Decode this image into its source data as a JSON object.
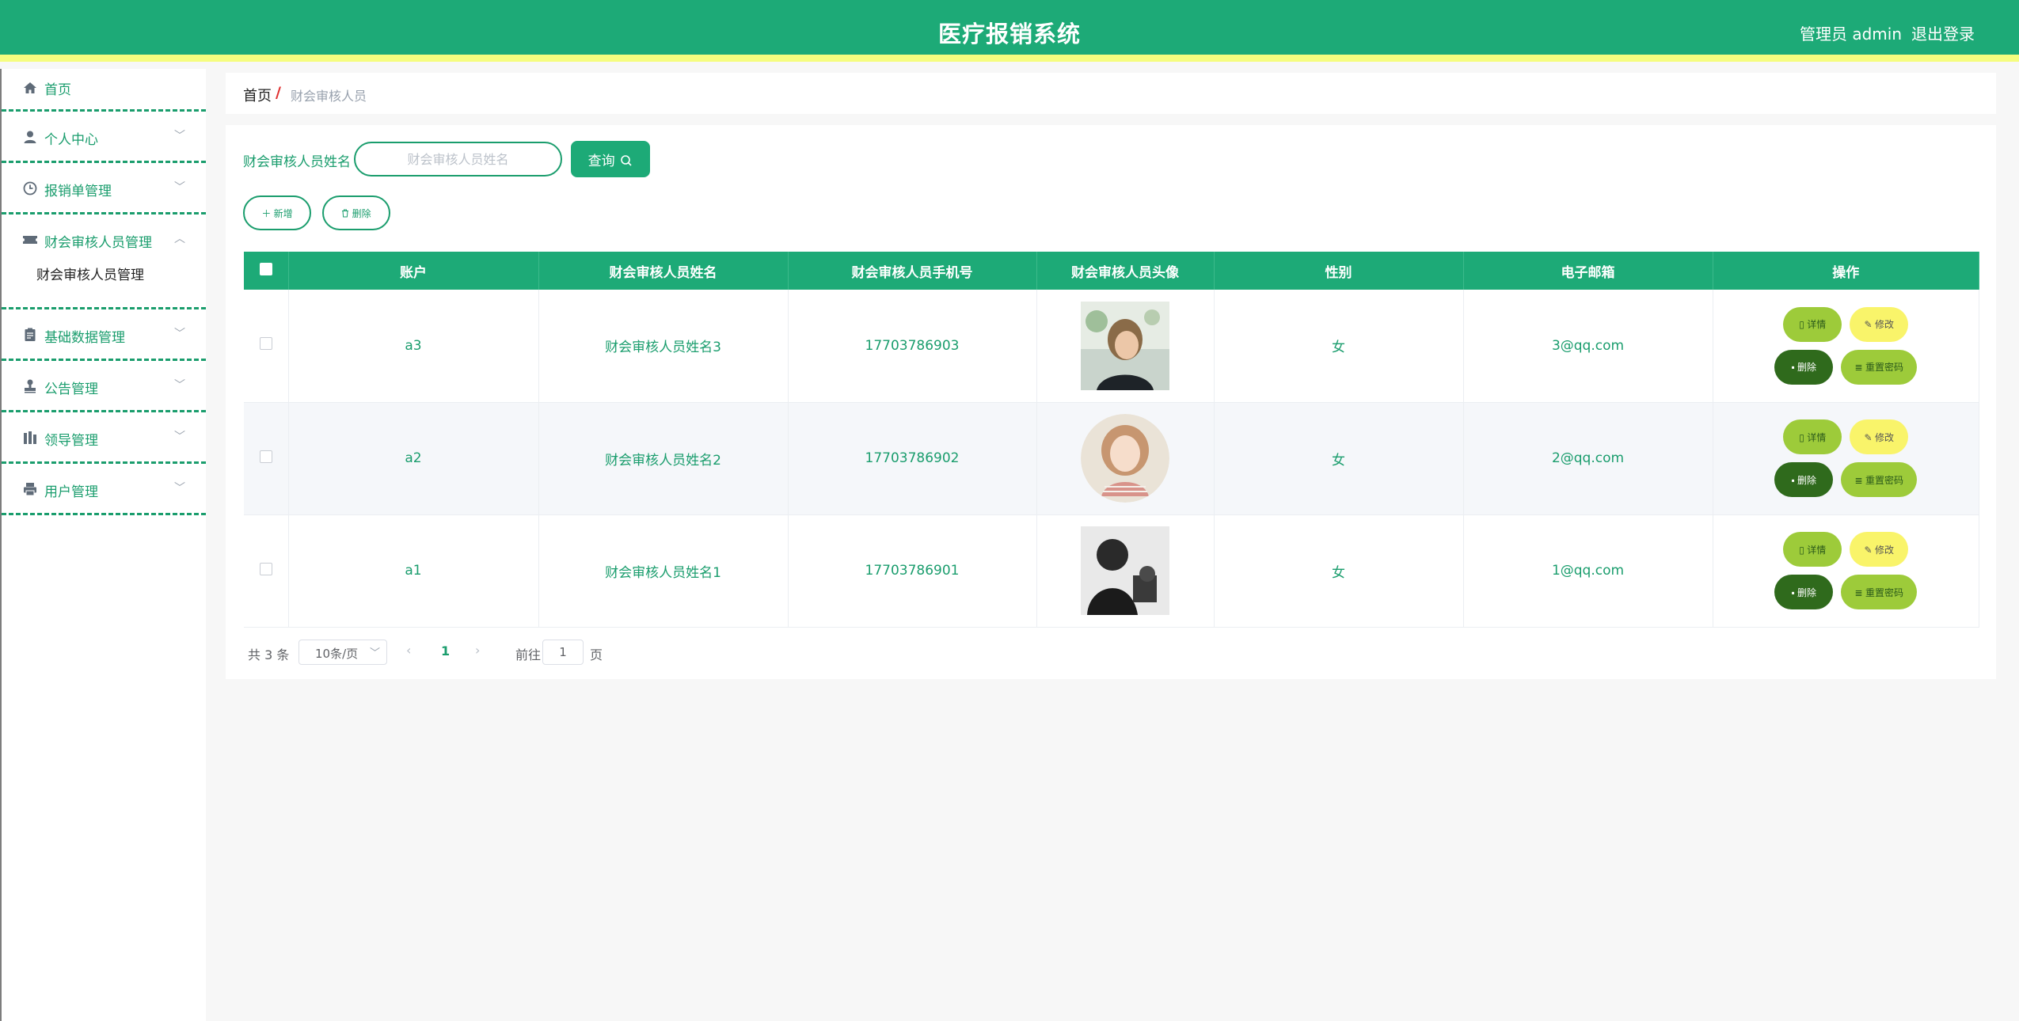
{
  "header": {
    "title": "医疗报销系统",
    "user": "管理员 admin",
    "logout": "退出登录"
  },
  "colors": {
    "primary": "#1daa77",
    "accent_strip": "#f5fd7f",
    "detail_btn": "#9dcb3a",
    "edit_btn": "#f9f46a",
    "delete_btn": "#2f6a1c"
  },
  "sidebar": {
    "items": [
      {
        "label": "首页",
        "icon": "home-icon"
      },
      {
        "label": "个人中心",
        "icon": "user-icon",
        "arrow": "﹀"
      },
      {
        "label": "报销单管理",
        "icon": "clock-icon",
        "arrow": "﹀"
      },
      {
        "label": "财会审核人员管理",
        "icon": "ticket-icon",
        "arrow": "︿",
        "sub": "财会审核人员管理"
      },
      {
        "label": "基础数据管理",
        "icon": "clipboard-icon",
        "arrow": "﹀"
      },
      {
        "label": "公告管理",
        "icon": "stamp-icon",
        "arrow": "﹀"
      },
      {
        "label": "领导管理",
        "icon": "building-icon",
        "arrow": "﹀"
      },
      {
        "label": "用户管理",
        "icon": "printer-icon",
        "arrow": "﹀"
      }
    ]
  },
  "breadcrumb": {
    "home": "首页",
    "separator": "/",
    "current": "财会审核人员"
  },
  "search": {
    "label": "财会审核人员姓名",
    "placeholder": "财会审核人员姓名",
    "button": "查询"
  },
  "actions": {
    "add": "新增",
    "delete": "删除"
  },
  "table": {
    "headers": [
      "账户",
      "财会审核人员姓名",
      "财会审核人员手机号",
      "财会审核人员头像",
      "性别",
      "电子邮箱",
      "操作"
    ],
    "rows": [
      {
        "account": "a3",
        "name": "财会审核人员姓名3",
        "phone": "17703786903",
        "gender": "女",
        "email": "3@qq.com"
      },
      {
        "account": "a2",
        "name": "财会审核人员姓名2",
        "phone": "17703786902",
        "gender": "女",
        "email": "2@qq.com"
      },
      {
        "account": "a1",
        "name": "财会审核人员姓名1",
        "phone": "17703786901",
        "gender": "女",
        "email": "1@qq.com"
      }
    ],
    "ops": {
      "detail": "详情",
      "edit": "修改",
      "delete": "删除",
      "reset": "重置密码"
    }
  },
  "pagination": {
    "total": "共 3 条",
    "page_size": "10条/页",
    "prev": "‹",
    "current": "1",
    "next": "›",
    "goto": "前往",
    "goto_value": "1",
    "page_suffix": "页"
  }
}
